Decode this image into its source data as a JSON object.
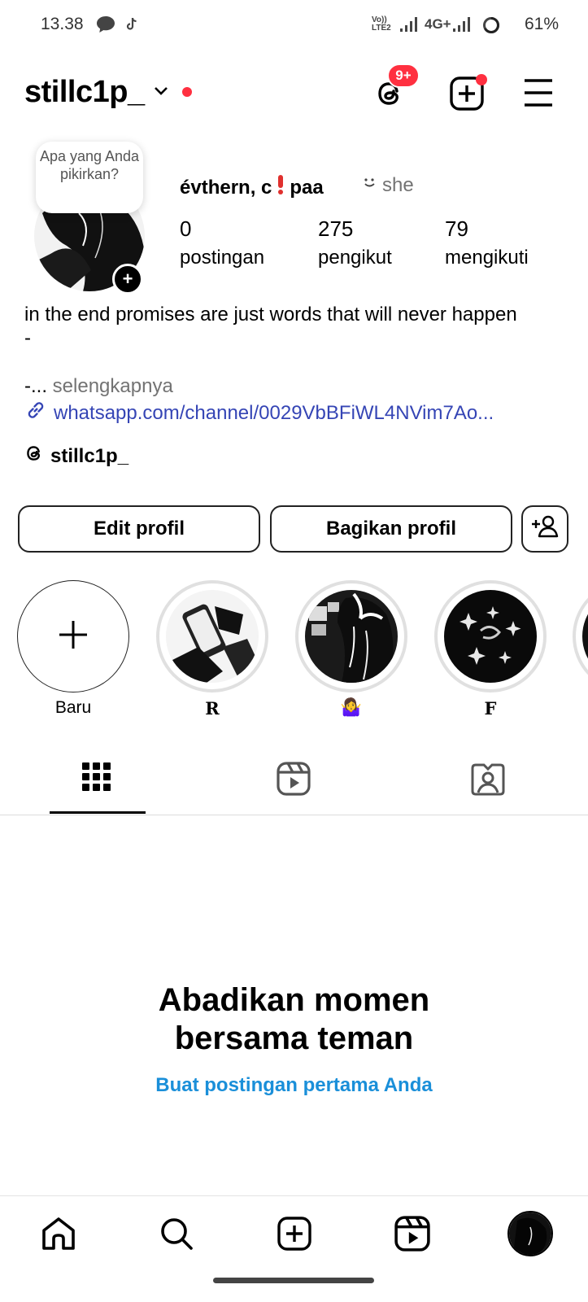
{
  "status_bar": {
    "time": "13.38",
    "network": "4G+",
    "volte": "Vo)) LTE2",
    "battery": "61%"
  },
  "header": {
    "username": "stillc1p_",
    "threads_badge": "9+"
  },
  "profile": {
    "note": "Apa yang Anda pikirkan?",
    "display_name": "évthern, c",
    "display_name_suffix": "paa",
    "pronoun": "she",
    "stats": [
      {
        "value": "0",
        "label": "postingan"
      },
      {
        "value": "275",
        "label": "pengikut"
      },
      {
        "value": "79",
        "label": "mengikuti"
      }
    ],
    "bio_line1": "in the end promises are just words that will never happen",
    "bio_line2": "-",
    "bio_more_prefix": "-...",
    "bio_more_label": "selengkapnya",
    "link": "whatsapp.com/channel/0029VbBFiWL4NVim7Ao...",
    "threads_handle": "stillc1p_"
  },
  "actions": {
    "edit": "Edit profil",
    "share": "Bagikan profil"
  },
  "highlights": [
    {
      "label": "Baru"
    },
    {
      "label": "R"
    },
    {
      "label": "🤷‍♀️"
    },
    {
      "label": "F"
    }
  ],
  "empty_state": {
    "title_line1": "Abadikan momen",
    "title_line2": "bersama teman",
    "cta": "Buat postingan pertama Anda"
  }
}
